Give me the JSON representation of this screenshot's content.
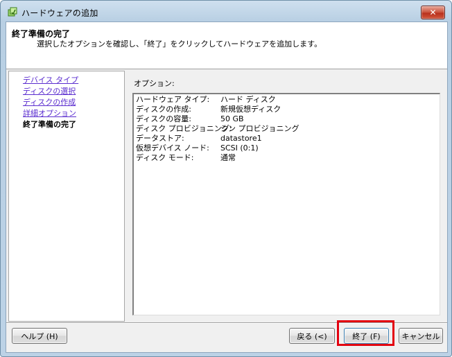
{
  "window": {
    "title": "ハードウェアの追加"
  },
  "header": {
    "title": "終了準備の完了",
    "description": "選択したオプションを確認し、「終了」をクリックしてハードウェアを追加します。"
  },
  "steps": [
    {
      "label": "デバイス タイプ",
      "state": "link"
    },
    {
      "label": "ディスクの選択",
      "state": "link"
    },
    {
      "label": "ディスクの作成",
      "state": "link"
    },
    {
      "label": "詳細オプション",
      "state": "link"
    },
    {
      "label": "終了準備の完了",
      "state": "current"
    }
  ],
  "options": {
    "label": "オプション:",
    "rows": [
      {
        "key": "ハードウェア タイプ:",
        "value": "ハード ディスク"
      },
      {
        "key": "ディスクの作成:",
        "value": "新規仮想ディスク"
      },
      {
        "key": "ディスクの容量:",
        "value": "50 GB"
      },
      {
        "key": "ディスク プロビジョニング:",
        "value": "シン プロビジョニング"
      },
      {
        "key": "データストア:",
        "value": "datastore1"
      },
      {
        "key": "仮想デバイス ノード:",
        "value": "SCSI (0:1)"
      },
      {
        "key": "ディスク モード:",
        "value": "通常"
      }
    ]
  },
  "buttons": {
    "help": "ヘルプ (H)",
    "back": "戻る (<)",
    "finish": "終了 (F)",
    "cancel": "キャンセル"
  },
  "colors": {
    "link": "#5a2ccf",
    "highlight": "#e3000f"
  },
  "icons": {
    "title": "add-hardware-icon",
    "close": "close-icon"
  }
}
